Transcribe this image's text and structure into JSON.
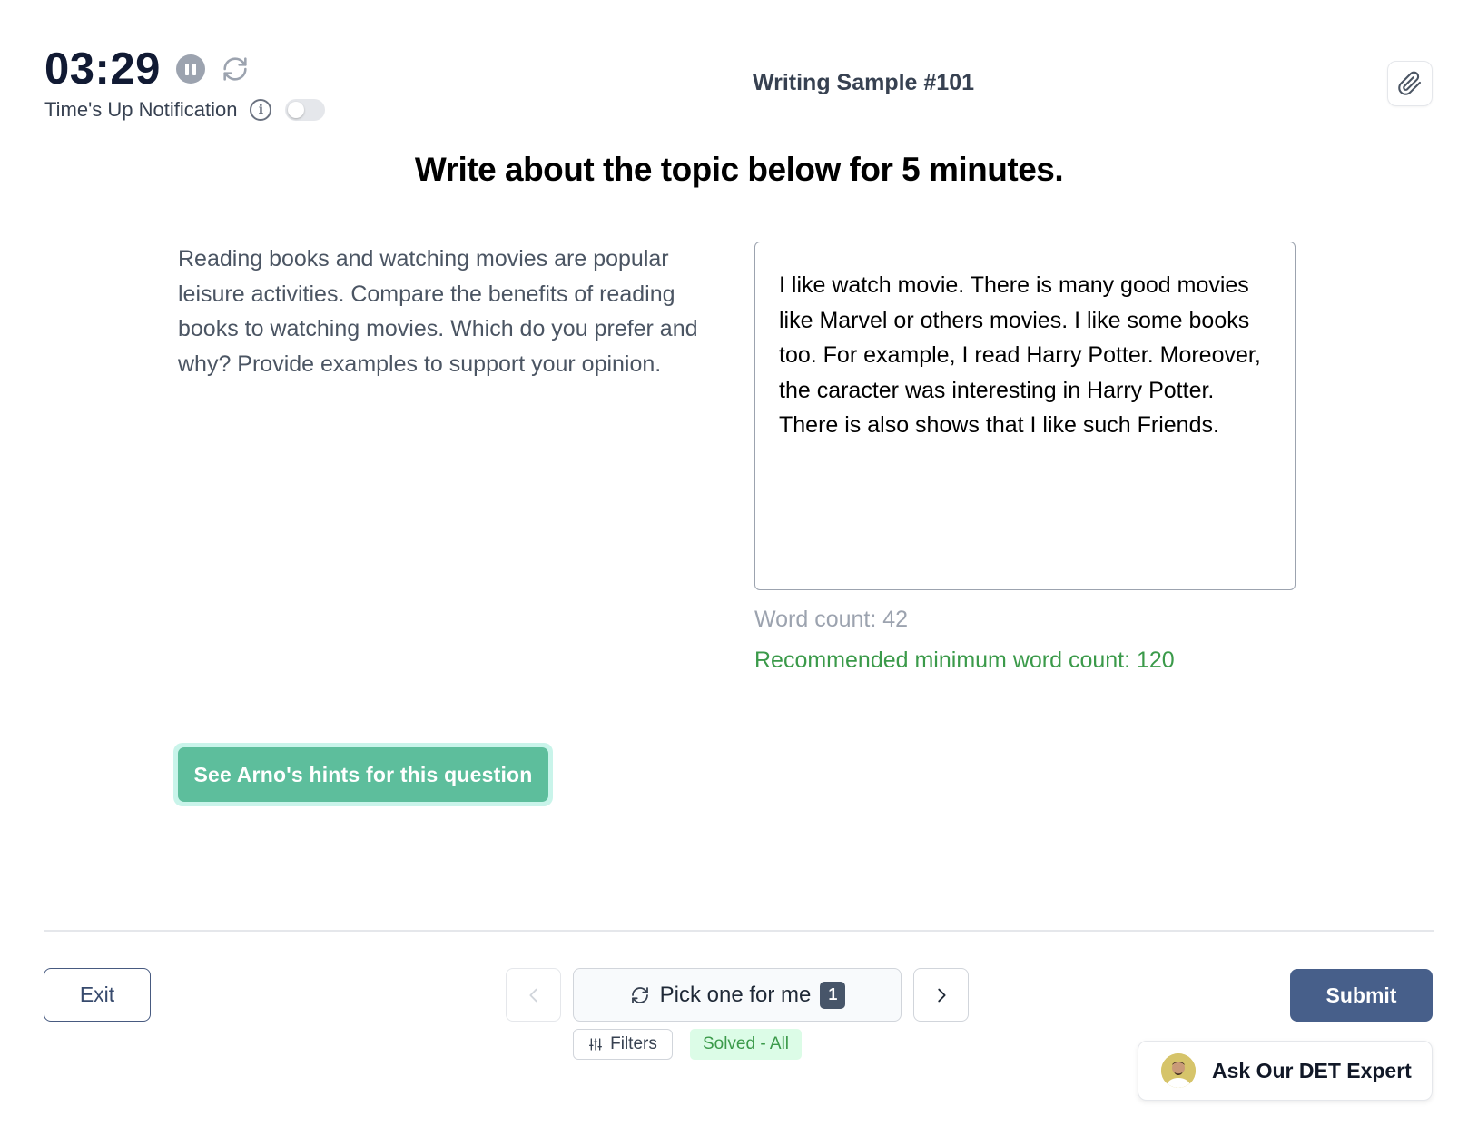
{
  "timer": {
    "time": "03:29",
    "notification_label": "Time's Up Notification",
    "notification_enabled": false
  },
  "header": {
    "sample_title": "Writing Sample #101"
  },
  "task": {
    "instruction": "Write about the topic below for 5 minutes.",
    "prompt": "Reading books and watching movies are popular leisure activities. Compare the benefits of reading books to watching movies. Which do you prefer and why? Provide examples to support your opinion."
  },
  "answer": {
    "text": "I like watch movie. There is many good movies like Marvel or others movies. I like some books too. For example, I read Harry Potter. Moreover, the caracter was interesting in Harry Potter. There is also shows that I like such Friends.",
    "word_count": "Word count: 42",
    "recommended": "Recommended minimum word count: 120"
  },
  "hints": {
    "label": "See Arno's hints for this question"
  },
  "footer": {
    "exit_label": "Exit",
    "pick_label": "Pick one for me",
    "pick_count": "1",
    "filters_label": "Filters",
    "solved_label": "Solved - All",
    "submit_label": "Submit",
    "expert_label": "Ask Our DET Expert"
  },
  "colors": {
    "accent_green": "#5dbe9c",
    "submit_blue": "#475f8a",
    "success_text": "#3b9a4a"
  },
  "icons": {
    "pause": "pause-icon",
    "reset": "refresh-icon",
    "info": "info-icon",
    "attach": "paperclip-icon",
    "prev": "chevron-left-icon",
    "next": "chevron-right-icon",
    "pick": "refresh-icon",
    "filters": "sliders-icon"
  }
}
